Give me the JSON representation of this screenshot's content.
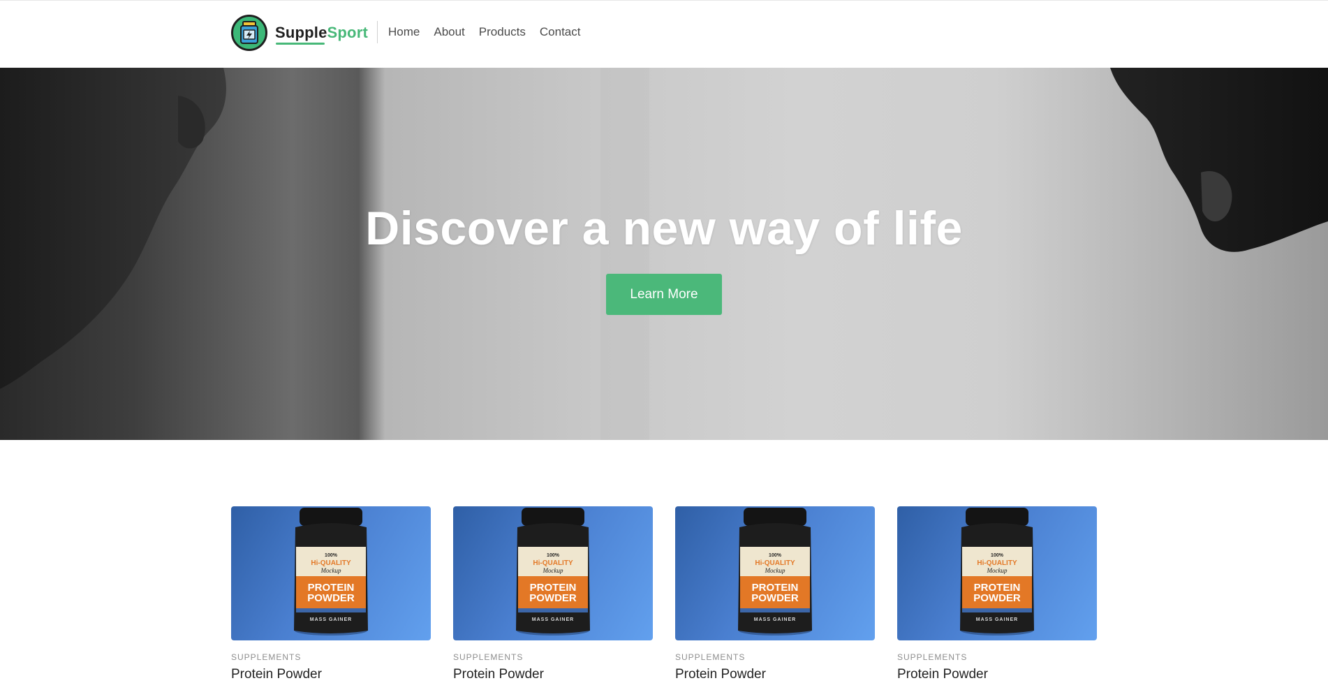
{
  "header": {
    "brand_part1": "Supple",
    "brand_part2": "Sport",
    "nav": [
      {
        "label": "Home"
      },
      {
        "label": "About"
      },
      {
        "label": "Products"
      },
      {
        "label": "Contact"
      }
    ]
  },
  "hero": {
    "title": "Discover a new way of life",
    "button_label": "Learn More"
  },
  "products": [
    {
      "category": "SUPPLEMENTS",
      "title": "Protein Powder",
      "jar_top": "100%",
      "jar_mid": "Hi-QUALITY",
      "jar_script": "Mockup",
      "jar_line1": "PROTEIN",
      "jar_line2": "POWDER",
      "jar_base": "MASS GAINER"
    },
    {
      "category": "SUPPLEMENTS",
      "title": "Protein Powder",
      "jar_top": "100%",
      "jar_mid": "Hi-QUALITY",
      "jar_script": "Mockup",
      "jar_line1": "PROTEIN",
      "jar_line2": "POWDER",
      "jar_base": "MASS GAINER"
    },
    {
      "category": "SUPPLEMENTS",
      "title": "Protein Powder",
      "jar_top": "100%",
      "jar_mid": "Hi-QUALITY",
      "jar_script": "Mockup",
      "jar_line1": "PROTEIN",
      "jar_line2": "POWDER",
      "jar_base": "MASS GAINER"
    },
    {
      "category": "SUPPLEMENTS",
      "title": "Protein Powder",
      "jar_top": "100%",
      "jar_mid": "Hi-QUALITY",
      "jar_script": "Mockup",
      "jar_line1": "PROTEIN",
      "jar_line2": "POWDER",
      "jar_base": "MASS GAINER"
    }
  ],
  "colors": {
    "accent": "#4bb87a",
    "brand_dark": "#1f1f1f",
    "card_blue": "#4a7fd0"
  }
}
